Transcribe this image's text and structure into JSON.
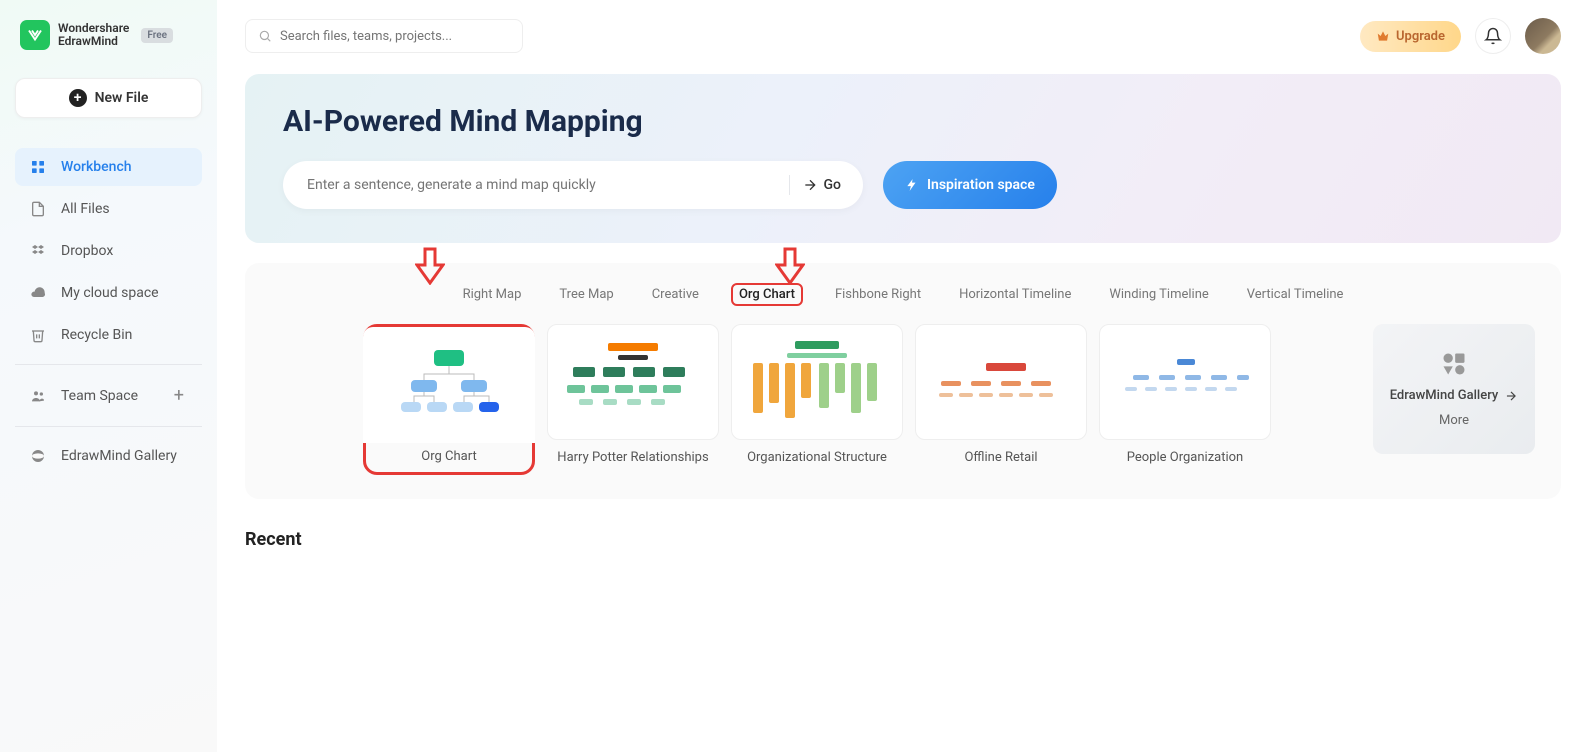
{
  "brand": {
    "line1": "Wondershare",
    "line2": "EdrawMind",
    "badge": "Free"
  },
  "sidebar": {
    "new_file": "New File",
    "items": [
      {
        "label": "Workbench"
      },
      {
        "label": "All Files"
      },
      {
        "label": "Dropbox"
      },
      {
        "label": "My cloud space"
      },
      {
        "label": "Recycle Bin"
      }
    ],
    "team_space": "Team Space",
    "gallery": "EdrawMind Gallery"
  },
  "topbar": {
    "search_placeholder": "Search files, teams, projects...",
    "upgrade": "Upgrade"
  },
  "hero": {
    "title": "AI-Powered Mind Mapping",
    "input_placeholder": "Enter a sentence, generate a mind map quickly",
    "go": "Go",
    "inspiration": "Inspiration space"
  },
  "templates": {
    "tabs": [
      "Right Map",
      "Tree Map",
      "Creative",
      "Org Chart",
      "Fishbone Right",
      "Horizontal Timeline",
      "Winding Timeline",
      "Vertical Timeline"
    ],
    "selected_index": 3,
    "cards": [
      {
        "label": "Org Chart"
      },
      {
        "label": "Harry Potter Relationships"
      },
      {
        "label": "Organizational Structure"
      },
      {
        "label": "Offline Retail"
      },
      {
        "label": "People Organization"
      }
    ],
    "gallery_card": "EdrawMind Gallery",
    "more": "More"
  },
  "recent_title": "Recent"
}
